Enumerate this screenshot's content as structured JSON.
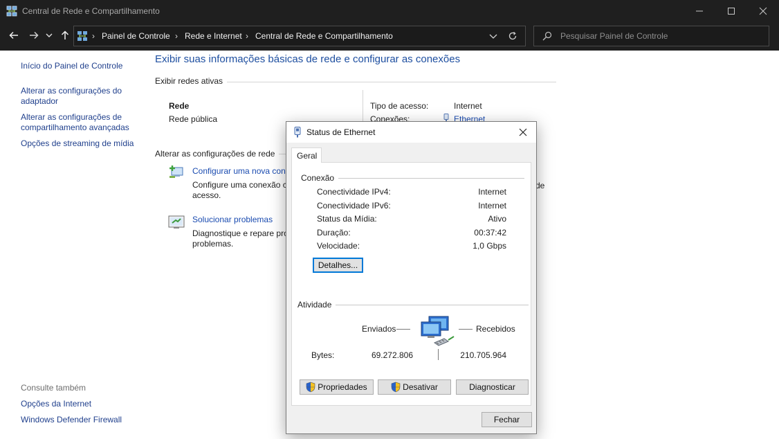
{
  "window": {
    "title": "Central de Rede e Compartilhamento"
  },
  "address": {
    "breadcrumbs": [
      "Painel de Controle",
      "Rede e Internet",
      "Central de Rede e Compartilhamento"
    ]
  },
  "search": {
    "placeholder": "Pesquisar Painel de Controle"
  },
  "sidebar": {
    "items": [
      {
        "label": "Início do Painel de Controle"
      },
      {
        "label": "Alterar as configurações do adaptador"
      },
      {
        "label": "Alterar as configurações de compartilhamento avançadas"
      },
      {
        "label": "Opções de streaming de mídia"
      }
    ],
    "see_also_label": "Consulte também",
    "see_also": [
      {
        "label": "Opções da Internet"
      },
      {
        "label": "Windows Defender Firewall"
      }
    ]
  },
  "main": {
    "title": "Exibir suas informações básicas de rede e configurar as conexões",
    "active_networks_heading": "Exibir redes ativas",
    "network": {
      "name": "Rede",
      "type": "Rede pública",
      "access_type_label": "Tipo de acesso:",
      "access_type_value": "Internet",
      "connections_label": "Conexões:",
      "connections_value": "Ethernet"
    },
    "change_settings_heading": "Alterar as configurações de rede",
    "tasks": [
      {
        "link": "Configurar uma nova con",
        "desc_line1": "Configure uma conexão c",
        "desc_line2": "acesso."
      },
      {
        "link": "Solucionar problemas",
        "desc_line1": "Diagnostique e repare pro",
        "desc_line2": "problemas."
      }
    ],
    "cut_text": "de"
  },
  "dialog": {
    "title": "Status de Ethernet",
    "tab": "Geral",
    "connection_heading": "Conexão",
    "rows": [
      {
        "label": "Conectividade IPv4:",
        "value": "Internet"
      },
      {
        "label": "Conectividade IPv6:",
        "value": "Internet"
      },
      {
        "label": "Status da Mídia:",
        "value": "Ativo"
      },
      {
        "label": "Duração:",
        "value": "00:37:42"
      },
      {
        "label": "Velocidade:",
        "value": "1,0 Gbps"
      }
    ],
    "details_button": "Detalhes...",
    "activity_heading": "Atividade",
    "sent_label": "Enviados",
    "received_label": "Recebidos",
    "bytes_label": "Bytes:",
    "bytes_sent": "69.272.806",
    "bytes_received": "210.705.964",
    "properties_button": "Propriedades",
    "disable_button": "Desativar",
    "diagnose_button": "Diagnosticar",
    "close_button": "Fechar"
  },
  "colors": {
    "titlebar_bg": "#1f1f1f",
    "link": "#1a4bb0",
    "title_blue": "#1e4fa0",
    "focus_blue": "#0078d7"
  }
}
